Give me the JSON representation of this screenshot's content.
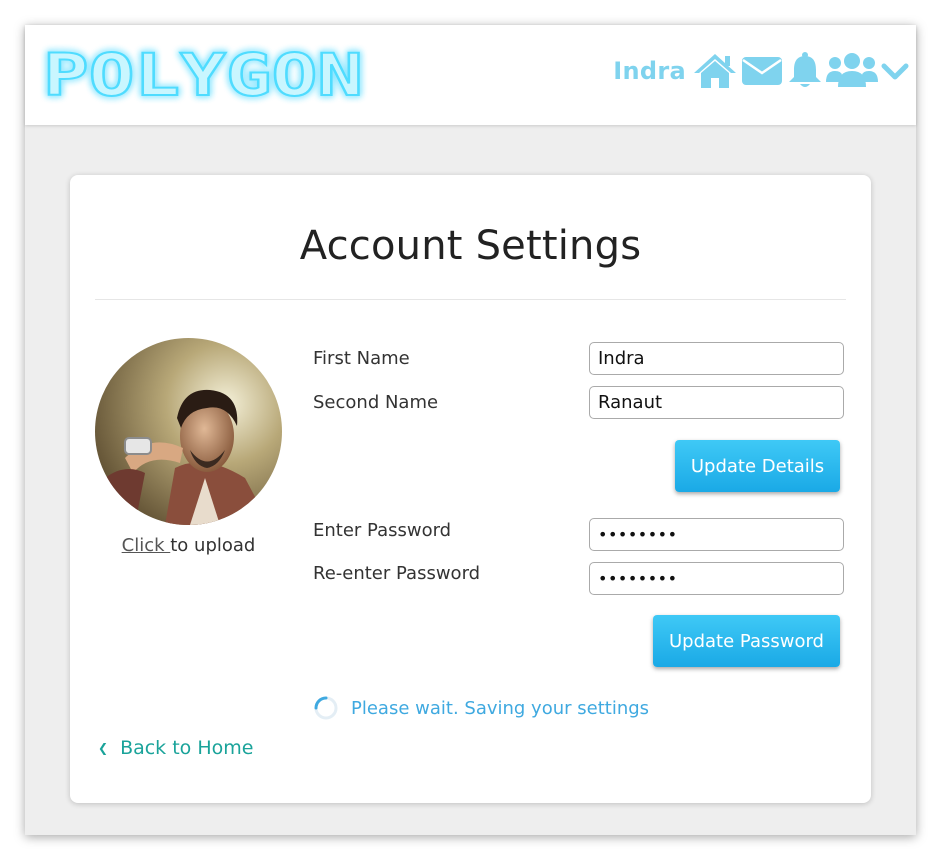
{
  "header": {
    "logo_text": "POLYGON",
    "user_name": "Indra",
    "icons": [
      "home-icon",
      "envelope-icon",
      "bell-icon",
      "users-icon",
      "chevron-down-icon"
    ]
  },
  "page": {
    "title": "Account Settings"
  },
  "profile": {
    "upload_link": "Click ",
    "upload_text": "to upload"
  },
  "details_form": {
    "first_name_label": "First Name",
    "first_name_value": "Indra",
    "second_name_label": "Second Name",
    "second_name_value": "Ranaut",
    "submit_label": "Update Details"
  },
  "password_form": {
    "password_label": "Enter Password",
    "password_value": "••••••••",
    "confirm_label": "Re-enter Password",
    "confirm_value": "••••••••",
    "submit_label": "Update Password"
  },
  "status": {
    "message": "Please wait. Saving your settings"
  },
  "footer": {
    "back_link": "Back to Home"
  },
  "colors": {
    "accent": "#1aa9e6",
    "logo_glow": "#7fe6ff",
    "nav_icons": "#7fd3ee",
    "back_link": "#1aa39a",
    "status_text": "#3fa9e0"
  }
}
